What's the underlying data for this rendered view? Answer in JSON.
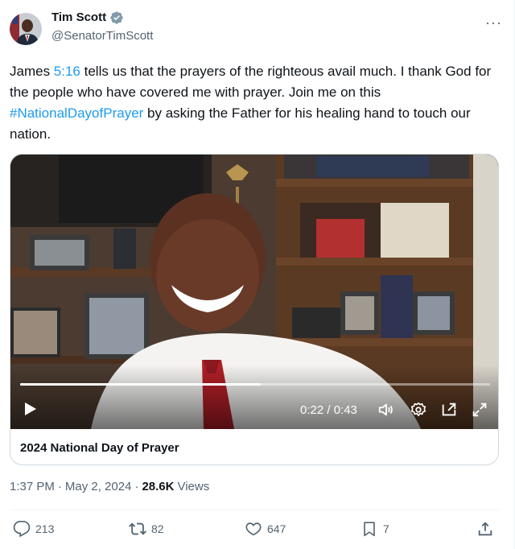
{
  "author": {
    "display_name": "Tim Scott",
    "handle": "@SenatorTimScott",
    "verified_icon": "verified-badge-icon"
  },
  "tweet": {
    "text_before_verse": "James ",
    "verse_link": "5:16",
    "text_after_verse": " tells us that the prayers of the righteous avail much. I thank God for the people who have covered me with prayer. Join me on this ",
    "hashtag": "#NationalDayofPrayer",
    "text_after_hashtag": " by asking the Father for his healing hand to touch our nation."
  },
  "video": {
    "time_display": "0:22 / 0:43",
    "progress": 0.512,
    "controls": [
      "play-icon",
      "volume-icon",
      "settings-icon",
      "dock-icon",
      "fullscreen-icon"
    ]
  },
  "card": {
    "title": "2024 National Day of Prayer"
  },
  "meta": {
    "time": "1:37 PM",
    "separator": "·",
    "date": "May 2, 2024",
    "views_count": "28.6K",
    "views_label": "Views"
  },
  "actions": {
    "replies": "213",
    "reposts": "82",
    "likes": "647",
    "bookmarks": "7"
  },
  "colors": {
    "link": "#1d9bf0",
    "text": "#0f1419",
    "muted": "#536471",
    "border": "#cfd9de"
  }
}
